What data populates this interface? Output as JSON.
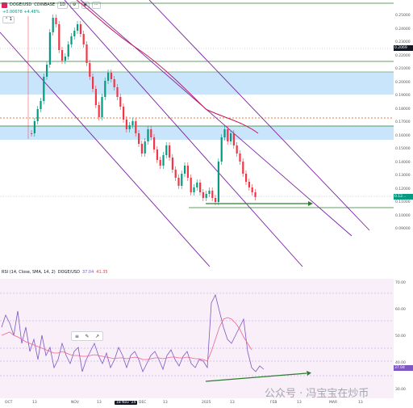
{
  "header": {
    "symbol": "DOGE/USD",
    "exchange": "COINBASE",
    "interval": "1D",
    "change": "+0.00678 +4.48%",
    "chip_label": "1"
  },
  "price_axis": {
    "ticks": [
      "0.25000",
      "0.24000",
      "0.23000",
      "0.22000",
      "0.21000",
      "0.20000",
      "0.19000",
      "0.18000",
      "0.17000",
      "0.16000",
      "0.15000",
      "0.14000",
      "0.13000",
      "0.12000",
      "0.11000",
      "0.10000",
      "0.09000"
    ],
    "label_top": "0.25",
    "current_tag": "0.12...",
    "level_tag": "0.2069"
  },
  "rsi": {
    "title": "RSI (14, Close, SMA, 14, 2)",
    "symbol": "DOGE/USD",
    "value1": "37.04",
    "value2": "41.35",
    "axis_ticks": [
      "70.00",
      "60.00",
      "50.00",
      "40.00",
      "30.00"
    ],
    "current_tag": "37.04"
  },
  "x_axis": {
    "labels": [
      "OCT",
      "13",
      "NOV",
      "13",
      "18 Nov '24",
      "DEC",
      "13",
      "2025",
      "13",
      "FEB",
      "13",
      "MAR",
      "13"
    ]
  },
  "drawing_toolbar": {
    "items": [
      "≡",
      "✎",
      "↗"
    ]
  },
  "watermark": "公众号 · 冯宝宝在炒币",
  "colors": {
    "up": "#089981",
    "down": "#f23645",
    "channel": "#7b1fa2",
    "ma": "#c2185b",
    "zone": "#bbdefb",
    "level_green": "#2e7d32",
    "rsi_line": "#7e57c2",
    "rsi_ma": "#f06292",
    "rsi_bg": "#f3e5f5"
  }
}
